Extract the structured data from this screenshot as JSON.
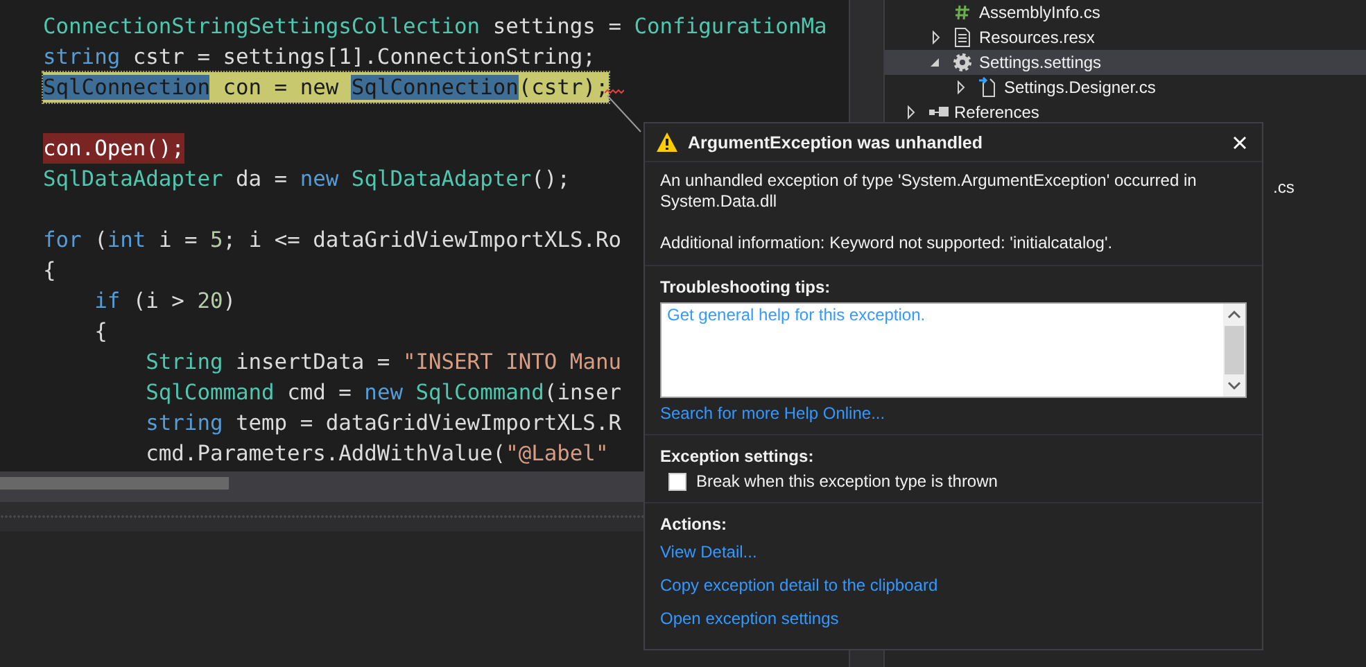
{
  "editor": {
    "lines": [
      {
        "kind": "code",
        "current": false,
        "error": false,
        "tokens": [
          {
            "kind": "type",
            "text": "ConnectionStringSettingsCollection"
          },
          {
            "kind": "plain",
            "text": " settings = "
          },
          {
            "kind": "type",
            "text": "ConfigurationMa"
          }
        ]
      },
      {
        "kind": "code",
        "current": false,
        "error": false,
        "tokens": [
          {
            "kind": "keyword",
            "text": "string"
          },
          {
            "kind": "plain",
            "text": " cstr = settings[1].ConnectionString;"
          }
        ]
      },
      {
        "kind": "code",
        "current": true,
        "error": false,
        "tokens": [
          {
            "kind": "type",
            "text": "SqlConnection"
          },
          {
            "kind": "plain",
            "text": " con = new "
          },
          {
            "kind": "type",
            "text": "SqlConnection"
          },
          {
            "kind": "plain",
            "text": "(cstr);"
          }
        ]
      },
      {
        "kind": "blank"
      },
      {
        "kind": "code",
        "current": false,
        "error": true,
        "tokens": [
          {
            "kind": "plain",
            "text": "con.Open();"
          }
        ]
      },
      {
        "kind": "code",
        "current": false,
        "error": false,
        "tokens": [
          {
            "kind": "type",
            "text": "SqlDataAdapter"
          },
          {
            "kind": "plain",
            "text": " da = "
          },
          {
            "kind": "keyword",
            "text": "new "
          },
          {
            "kind": "type",
            "text": "SqlDataAdapter"
          },
          {
            "kind": "plain",
            "text": "();"
          }
        ]
      },
      {
        "kind": "blank"
      },
      {
        "kind": "code",
        "current": false,
        "error": false,
        "tokens": [
          {
            "kind": "keyword",
            "text": "for"
          },
          {
            "kind": "plain",
            "text": " ("
          },
          {
            "kind": "keyword",
            "text": "int"
          },
          {
            "kind": "plain",
            "text": " i = "
          },
          {
            "kind": "number",
            "text": "5"
          },
          {
            "kind": "plain",
            "text": "; i <= dataGridViewImportXLS.Ro"
          }
        ]
      },
      {
        "kind": "code",
        "current": false,
        "error": false,
        "tokens": [
          {
            "kind": "plain",
            "text": "{"
          }
        ],
        "children": [
          {
            "kind": "code",
            "current": false,
            "error": false,
            "tokens": [
              {
                "kind": "keyword",
                "text": "if"
              },
              {
                "kind": "plain",
                "text": " (i > "
              },
              {
                "kind": "number",
                "text": "20"
              },
              {
                "kind": "plain",
                "text": ")"
              }
            ]
          },
          {
            "kind": "code",
            "current": false,
            "error": false,
            "tokens": [
              {
                "kind": "plain",
                "text": "{"
              }
            ],
            "children": [
              {
                "kind": "code",
                "current": false,
                "error": false,
                "tokens": [
                  {
                    "kind": "type",
                    "text": "String"
                  },
                  {
                    "kind": "plain",
                    "text": " insertData = "
                  },
                  {
                    "kind": "string",
                    "text": "\"INSERT INTO Manu"
                  }
                ]
              },
              {
                "kind": "code",
                "current": false,
                "error": false,
                "tokens": [
                  {
                    "kind": "type",
                    "text": "SqlCommand"
                  },
                  {
                    "kind": "plain",
                    "text": " cmd = "
                  },
                  {
                    "kind": "keyword",
                    "text": "new "
                  },
                  {
                    "kind": "type",
                    "text": "SqlCommand"
                  },
                  {
                    "kind": "plain",
                    "text": "(inser"
                  }
                ]
              },
              {
                "kind": "code",
                "current": false,
                "error": false,
                "tokens": [
                  {
                    "kind": "keyword",
                    "text": "string"
                  },
                  {
                    "kind": "plain",
                    "text": " temp = dataGridViewImportXLS.R"
                  }
                ]
              },
              {
                "kind": "code",
                "current": false,
                "error": false,
                "tokens": [
                  {
                    "kind": "plain",
                    "text": "cmd.Parameters.AddWithValue("
                  },
                  {
                    "kind": "string",
                    "text": "\"@Label\""
                  }
                ]
              }
            ]
          }
        ]
      }
    ]
  },
  "solution_explorer": {
    "items": [
      {
        "kind": "group",
        "children": [
          {
            "kind": "csharp",
            "label": "AssemblyInfo.cs",
            "selected": false
          },
          {
            "kind": "resource",
            "label": "Resources.resx",
            "selected": false,
            "expanded": false
          },
          {
            "kind": "settings",
            "label": "Settings.settings",
            "selected": true,
            "expanded": true,
            "children": [
              {
                "kind": "designer",
                "label": "Settings.Designer.cs",
                "selected": false,
                "expanded": false
              }
            ]
          }
        ]
      },
      {
        "kind": "references",
        "label": "References",
        "selected": false,
        "expanded": false
      },
      {
        "kind": "clipped",
        "label": ".cs"
      }
    ]
  },
  "exception_popup": {
    "title": "ArgumentException was unhandled",
    "message": "An unhandled exception of type 'System.ArgumentException' occurred in System.Data.dll",
    "additional_info": "Additional information: Keyword not supported: 'initialcatalog'.",
    "troubleshooting": {
      "heading": "Troubleshooting tips:",
      "tips": [
        "Get general help for this exception."
      ],
      "search_link": "Search for more Help Online..."
    },
    "settings": {
      "heading": "Exception settings:",
      "checkbox": {
        "label": "Break when this exception type is thrown",
        "checked": false
      }
    },
    "actions": {
      "heading": "Actions:",
      "links": [
        "View Detail...",
        "Copy exception detail to the clipboard",
        "Open exception settings"
      ]
    }
  }
}
